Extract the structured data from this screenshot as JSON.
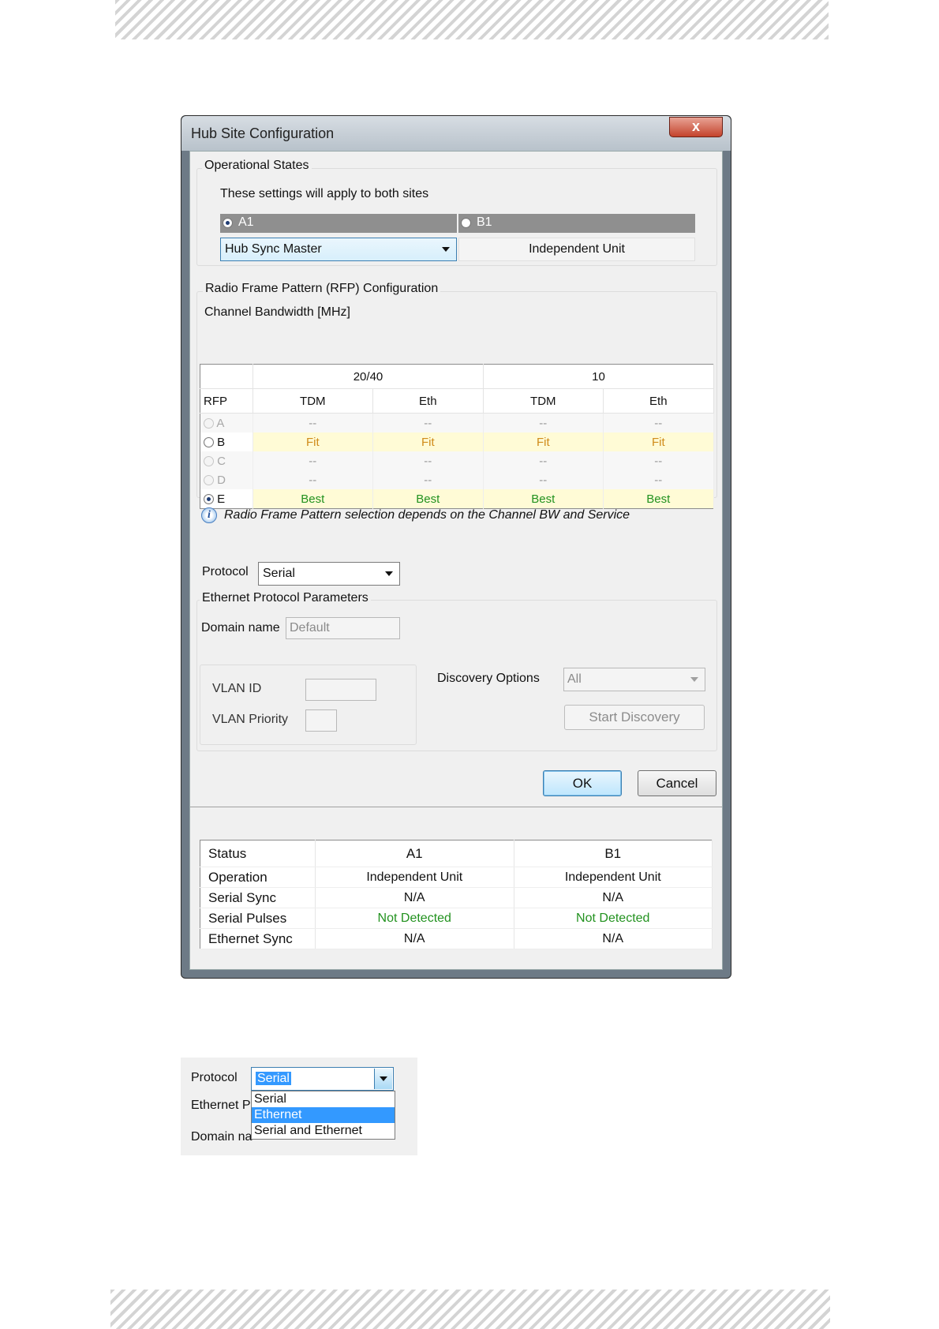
{
  "window": {
    "title": "Hub Site Configuration",
    "close_glyph": "x"
  },
  "operational_states": {
    "group_label": "Operational States",
    "note": "These settings will apply to both sites",
    "site_a": {
      "label": "A1",
      "selected": true,
      "mode": "Hub Sync Master"
    },
    "site_b": {
      "label": "B1",
      "selected": false,
      "mode": "Independent Unit"
    }
  },
  "rfp": {
    "group_label": "Radio Frame Pattern (RFP) Configuration",
    "bandwidth_label": "Channel Bandwidth [MHz]",
    "bandwidth_headers": [
      "20/40",
      "10"
    ],
    "column_headers": [
      "RFP",
      "TDM",
      "Eth",
      "TDM",
      "Eth"
    ],
    "rows": [
      {
        "name": "A",
        "enabled": false,
        "selected": false,
        "cells": [
          "--",
          "--",
          "--",
          "--"
        ]
      },
      {
        "name": "B",
        "enabled": true,
        "selected": false,
        "cells": [
          "Fit",
          "Fit",
          "Fit",
          "Fit"
        ]
      },
      {
        "name": "C",
        "enabled": false,
        "selected": false,
        "cells": [
          "--",
          "--",
          "--",
          "--"
        ]
      },
      {
        "name": "D",
        "enabled": false,
        "selected": false,
        "cells": [
          "--",
          "--",
          "--",
          "--"
        ]
      },
      {
        "name": "E",
        "enabled": true,
        "selected": true,
        "cells": [
          "Best",
          "Best",
          "Best",
          "Best"
        ]
      }
    ],
    "info_text": "Radio Frame Pattern selection depends on the Channel BW and Service"
  },
  "protocol": {
    "label": "Protocol",
    "value": "Serial"
  },
  "ethernet": {
    "group_label": "Ethernet Protocol Parameters",
    "domain_label": "Domain name",
    "domain_value": "Default",
    "vlan_id_label": "VLAN ID",
    "vlan_priority_label": "VLAN Priority",
    "discovery_label": "Discovery Options",
    "discovery_value": "All",
    "start_discovery": "Start Discovery"
  },
  "buttons": {
    "ok": "OK",
    "cancel": "Cancel"
  },
  "status": {
    "headers": [
      "Status",
      "A1",
      "B1"
    ],
    "rows": [
      [
        "Operation",
        "Independent Unit",
        "Independent Unit"
      ],
      [
        "Serial Sync",
        "N/A",
        "N/A"
      ],
      [
        "Serial Pulses",
        "Not Detected",
        "Not Detected"
      ],
      [
        "Ethernet Sync",
        "N/A",
        "N/A"
      ]
    ]
  },
  "snippet": {
    "protocol_label": "Protocol",
    "protocol_value": "Serial",
    "ethernet_label_partial": "Ethernet P",
    "domain_label_partial": "Domain na",
    "options": [
      "Serial",
      "Ethernet",
      "Serial and Ethernet"
    ],
    "highlighted_option": "Ethernet"
  }
}
